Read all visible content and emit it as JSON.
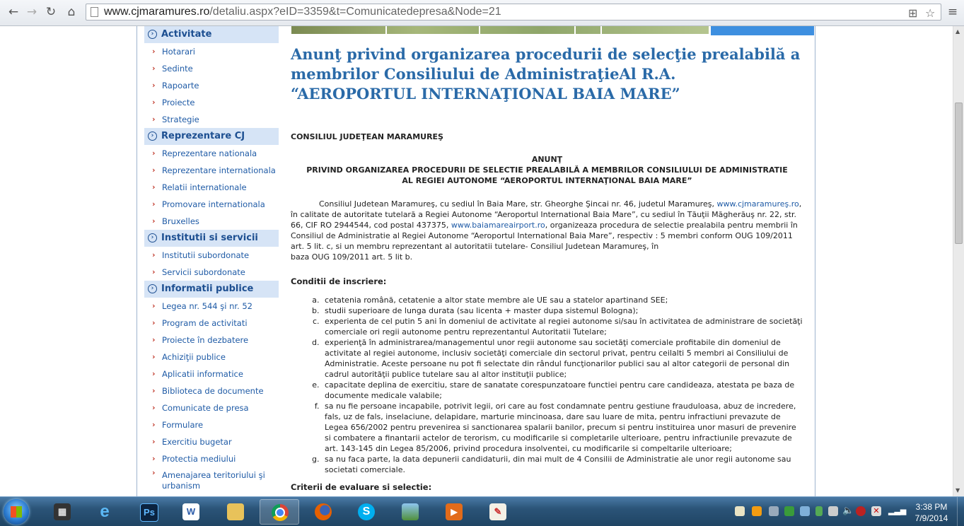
{
  "browser": {
    "url_host": "www.cjmaramures.ro",
    "url_path": "/detaliu.aspx?eID=3359&t=Comunicatedepresa&Node=21"
  },
  "sidebar": {
    "sections": [
      {
        "title": "Activitate",
        "items": [
          "Hotarari",
          "Sedinte",
          "Rapoarte",
          "Proiecte",
          "Strategie"
        ]
      },
      {
        "title": "Reprezentare CJ",
        "items": [
          "Reprezentare nationala",
          "Reprezentare internationala",
          "Relatii internationale",
          "Promovare internationala",
          "Bruxelles"
        ]
      },
      {
        "title": "Institutii si servicii",
        "items": [
          "Institutii subordonate",
          "Servicii subordonate"
        ]
      },
      {
        "title": "Informatii publice",
        "items": [
          "Legea nr. 544 şi nr. 52",
          "Program de activitati",
          "Proiecte în dezbatere",
          "Achiziţii publice",
          "Aplicatii informatice",
          "Biblioteca de documente",
          "Comunicate de presa",
          "Formulare",
          "Exercitiu bugetar",
          "Protectia mediului",
          "Amenajarea teritoriului şi urbanism"
        ]
      }
    ]
  },
  "article": {
    "title": "Anunţ privind organizarea procedurii de selecţie prealabilă a membrilor Consiliului de AdministraţieAl R.A. “AEROPORTUL INTERNAŢIONAL BAIA MARE”",
    "org": "CONSILIUL JUDEŢEAN MARAMUREŞ",
    "heading_1": "ANUNŢ",
    "heading_2": "PRIVIND ORGANIZAREA PROCEDURII DE SELECTIE PREALABILĂ A MEMBRILOR CONSILIULUI DE ADMINISTRATIE",
    "heading_3": "AL REGIEI AUTONOME “AEROPORTUL INTERNAŢIONAL BAIA MARE”",
    "para_1": "Consiliul Judetean Maramureş, cu sediul în Baia Mare, str. Gheorghe Şincai nr. 46, judetul Maramureş,",
    "link_1": "www.cjmaramureş.ro",
    "para_2": ", în calitate de autoritate tutelară a Regiei Autonome “Aeroportul International Baia Mare”, cu sediul în Tăuţii Măgherăuş nr. 22, str. 66, CIF RO 2944544, cod postal 437375,",
    "link_2": "www.baiamareairport.ro",
    "para_3": ", organizeaza procedura de selectie prealabila pentru membrii în Consiliul de Administratie al Regiei Autonome “Aeroportul International Baia Mare”, respectiv : 5 membri conform OUG 109/2011 art. 5 lit. c, si un membru reprezentant al autoritatii tutelare- Consiliul Judetean Maramureş, în",
    "para_4": "baza OUG 109/2011 art. 5 lit b.",
    "conditions_heading": "Conditii de inscriere:",
    "conditions": [
      "cetatenia română, cetatenie a altor state membre ale UE sau a statelor apartinand SEE;",
      "studii superioare de lunga durata (sau licenta + master dupa sistemul Bologna);",
      "experienta de cel putin 5 ani în domeniul de activitate al regiei autonome si/sau în activitatea de administrare de societăţi comerciale ori regii autonome pentru reprezentantul Autoritatii Tutelare;",
      "experienţă în administrarea/managementul unor regii autonome sau societăţi comerciale profitabile din domeniul de activitate al regiei autonome, inclusiv societăţi comerciale din sectorul privat, pentru ceilalti 5 membri ai Consiliului de Administratie. Aceste persoane nu pot fi selectate din rândul funcţionarilor publici sau al altor categorii de personal din cadrul autorităţii publice tutelare sau al altor instituţii publice;",
      "capacitate deplina de exercitiu, stare de sanatate corespunzatoare functiei pentru care candideaza, atestata pe baza de documente medicale valabile;",
      "sa nu fie persoane incapabile, potrivit legii, ori care au fost condamnate pentru gestiune frauduloasa, abuz de incredere, fals, uz de fals, inselaciune, delapidare, marturie mincinoasa, dare sau luare de mita, pentru infractiuni prevazute de Legea 656/2002 pentru prevenirea si sanctionarea spalarii banilor, precum si pentru instituirea unor masuri de prevenire si combatere a finantarii actelor de terorism, cu modificarile si completarile ulterioare, pentru infractiunile prevazute de art. 143-145 din Legea 85/2006, privind procedura insolventei, cu modificarile si compeltarile ulterioare;",
      "sa nu faca parte, la data depunerii candidaturii, din mai mult de 4 Consilii de Administratie ale unor regii autonome sau societati comerciale."
    ],
    "criteria_heading": "Criterii de evaluare si selectie:"
  },
  "taskbar": {
    "apps": [
      "media-player",
      "internet-explorer",
      "photoshop",
      "word",
      "file-explorer",
      "chrome",
      "firefox",
      "skype",
      "image-viewer",
      "slideshow",
      "paint"
    ],
    "time": "3:38 PM",
    "date": "7/9/2014"
  }
}
